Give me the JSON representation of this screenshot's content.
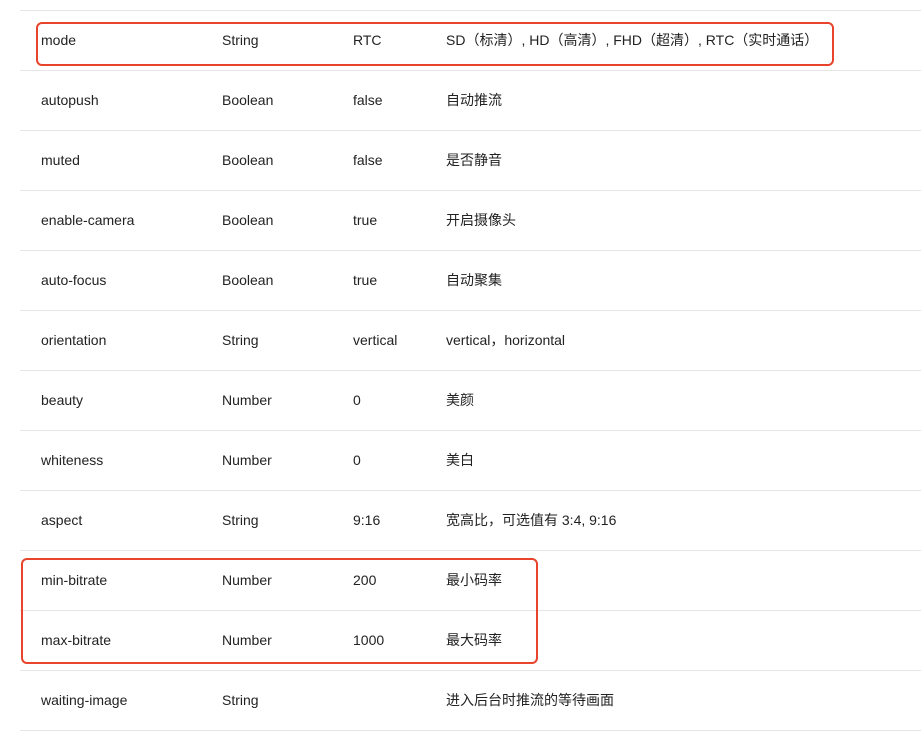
{
  "rows": [
    {
      "name": "mode",
      "type": "String",
      "default": "RTC",
      "description": "SD（标清）, HD（高清）, FHD（超清）, RTC（实时通话）"
    },
    {
      "name": "autopush",
      "type": "Boolean",
      "default": "false",
      "description": "自动推流"
    },
    {
      "name": "muted",
      "type": "Boolean",
      "default": "false",
      "description": "是否静音"
    },
    {
      "name": "enable-camera",
      "type": "Boolean",
      "default": "true",
      "description": "开启摄像头"
    },
    {
      "name": "auto-focus",
      "type": "Boolean",
      "default": "true",
      "description": "自动聚集"
    },
    {
      "name": "orientation",
      "type": "String",
      "default": "vertical",
      "description": "vertical，horizontal"
    },
    {
      "name": "beauty",
      "type": "Number",
      "default": "0",
      "description": "美颜"
    },
    {
      "name": "whiteness",
      "type": "Number",
      "default": "0",
      "description": "美白"
    },
    {
      "name": "aspect",
      "type": "String",
      "default": "9:16",
      "description": "宽高比，可选值有 3:4, 9:16"
    },
    {
      "name": "min-bitrate",
      "type": "Number",
      "default": "200",
      "description": "最小码率"
    },
    {
      "name": "max-bitrate",
      "type": "Number",
      "default": "1000",
      "description": "最大码率"
    },
    {
      "name": "waiting-image",
      "type": "String",
      "default": "",
      "description": "进入后台时推流的等待画面"
    }
  ],
  "highlight_color": "#e8432b",
  "divider_color": "#e6e6e6"
}
